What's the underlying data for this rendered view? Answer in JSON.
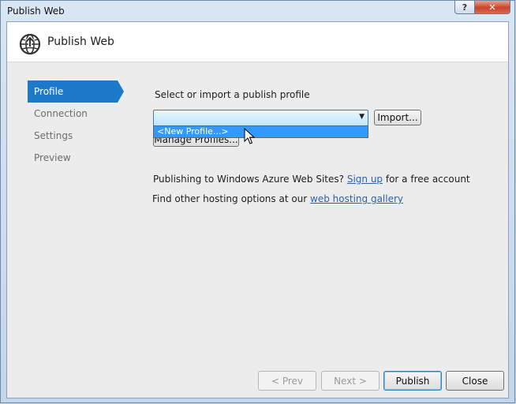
{
  "window": {
    "title": "Publish Web",
    "help_glyph": "?",
    "close_glyph": "✕"
  },
  "header": {
    "title": "Publish Web",
    "icon": "globe-publish-icon"
  },
  "nav": {
    "items": [
      {
        "label": "Profile",
        "active": true
      },
      {
        "label": "Connection",
        "active": false
      },
      {
        "label": "Settings",
        "active": false
      },
      {
        "label": "Preview",
        "active": false
      }
    ]
  },
  "profile": {
    "select_label": "Select or import a publish profile",
    "combo_value": "",
    "dropdown_options": [
      "<New Profile...>"
    ],
    "import_button": "Import...",
    "manage_button": "Manage Profiles..."
  },
  "azure": {
    "text_before": "Publishing to Windows Azure Web Sites? ",
    "link": "Sign up",
    "text_after": " for a free account"
  },
  "hosting": {
    "text_before": "Find other hosting options at our ",
    "link": "web hosting gallery"
  },
  "footer": {
    "prev": "< Prev",
    "next": "Next >",
    "publish": "Publish",
    "close": "Close"
  },
  "colors": {
    "accent": "#1c79c9",
    "selection": "#3399ff",
    "link": "#2a62b2"
  }
}
